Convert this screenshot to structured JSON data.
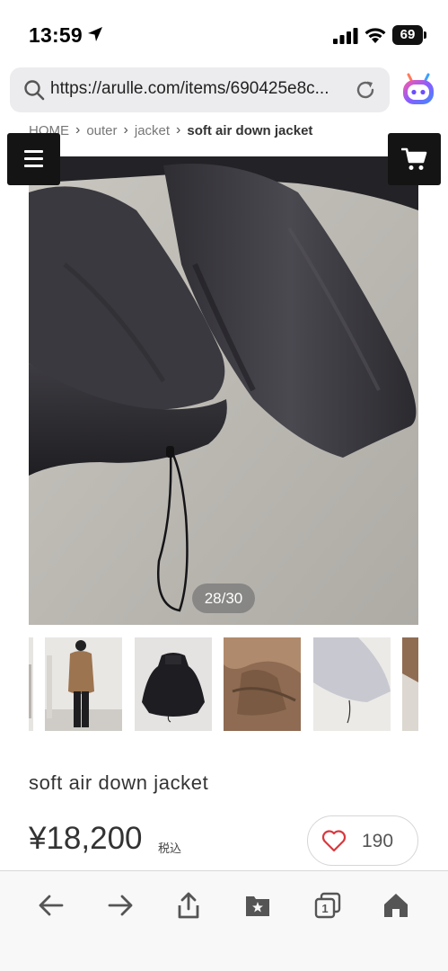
{
  "status_bar": {
    "time": "13:59",
    "battery": "69"
  },
  "browser": {
    "url": "https://arulle.com/items/690425e8c...",
    "icons": [
      "search-icon",
      "reload-icon",
      "assistant-icon"
    ]
  },
  "breadcrumb": {
    "items": [
      "HOME",
      "outer",
      "jacket"
    ],
    "current": "soft air down jacket"
  },
  "gallery": {
    "counter": "28/30",
    "current_index": 28,
    "total": 30
  },
  "product": {
    "title": "soft air down jacket",
    "price": "¥18,200",
    "tax_label": "税込",
    "like_count": "190"
  },
  "colors": {
    "button_dark": "#141414",
    "heart_red": "#d9383e"
  },
  "toolbar": {
    "icons": [
      "back-icon",
      "forward-icon",
      "share-icon",
      "bookmarks-icon",
      "tabs-icon",
      "home-icon"
    ],
    "tab_count": "1"
  }
}
